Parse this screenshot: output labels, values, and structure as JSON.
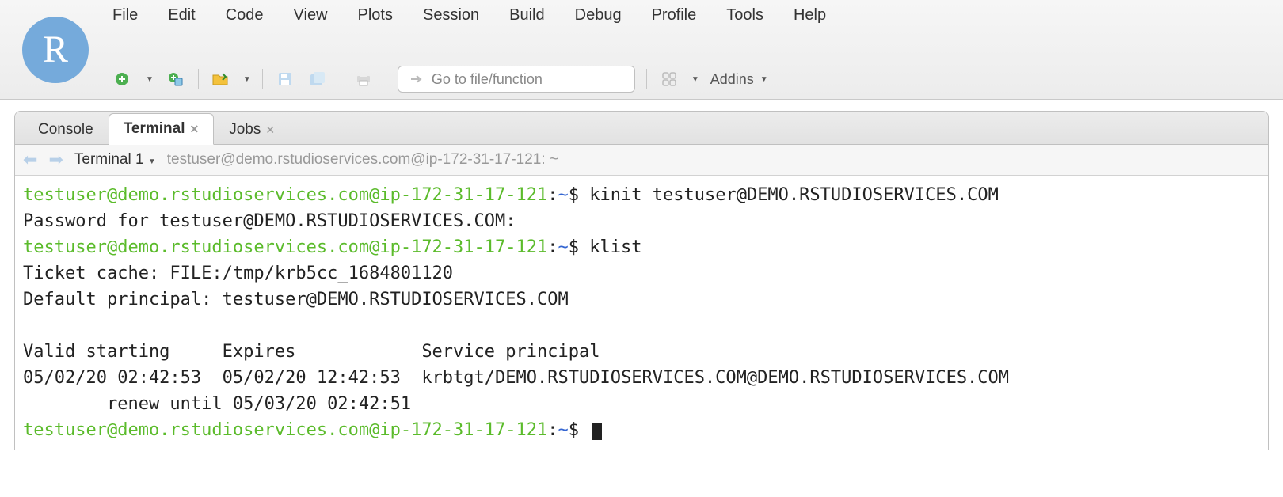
{
  "logo_letter": "R",
  "menu": {
    "file": "File",
    "edit": "Edit",
    "code": "Code",
    "view": "View",
    "plots": "Plots",
    "session": "Session",
    "build": "Build",
    "debug": "Debug",
    "profile": "Profile",
    "tools": "Tools",
    "help": "Help"
  },
  "toolbar": {
    "goto_placeholder": "Go to file/function",
    "addins_label": "Addins"
  },
  "tabs": {
    "console": "Console",
    "terminal": "Terminal",
    "jobs": "Jobs"
  },
  "subbar": {
    "terminal_label": "Terminal 1",
    "path": "testuser@demo.rstudioservices.com@ip-172-31-17-121: ~"
  },
  "terminal": {
    "prompt_user": "testuser@demo.rstudioservices.com@ip-172-31-17-121",
    "colon": ":",
    "tilde": "~",
    "dollar": "$ ",
    "cmd1": "kinit testuser@DEMO.RSTUDIOSERVICES.COM",
    "line2": "Password for testuser@DEMO.RSTUDIOSERVICES.COM:",
    "cmd2": "klist",
    "line4": "Ticket cache: FILE:/tmp/krb5cc_1684801120",
    "line5": "Default principal: testuser@DEMO.RSTUDIOSERVICES.COM",
    "blank": "",
    "line7": "Valid starting     Expires            Service principal",
    "line8": "05/02/20 02:42:53  05/02/20 12:42:53  krbtgt/DEMO.RSTUDIOSERVICES.COM@DEMO.RSTUDIOSERVICES.COM",
    "line9": "        renew until 05/03/20 02:42:51"
  }
}
